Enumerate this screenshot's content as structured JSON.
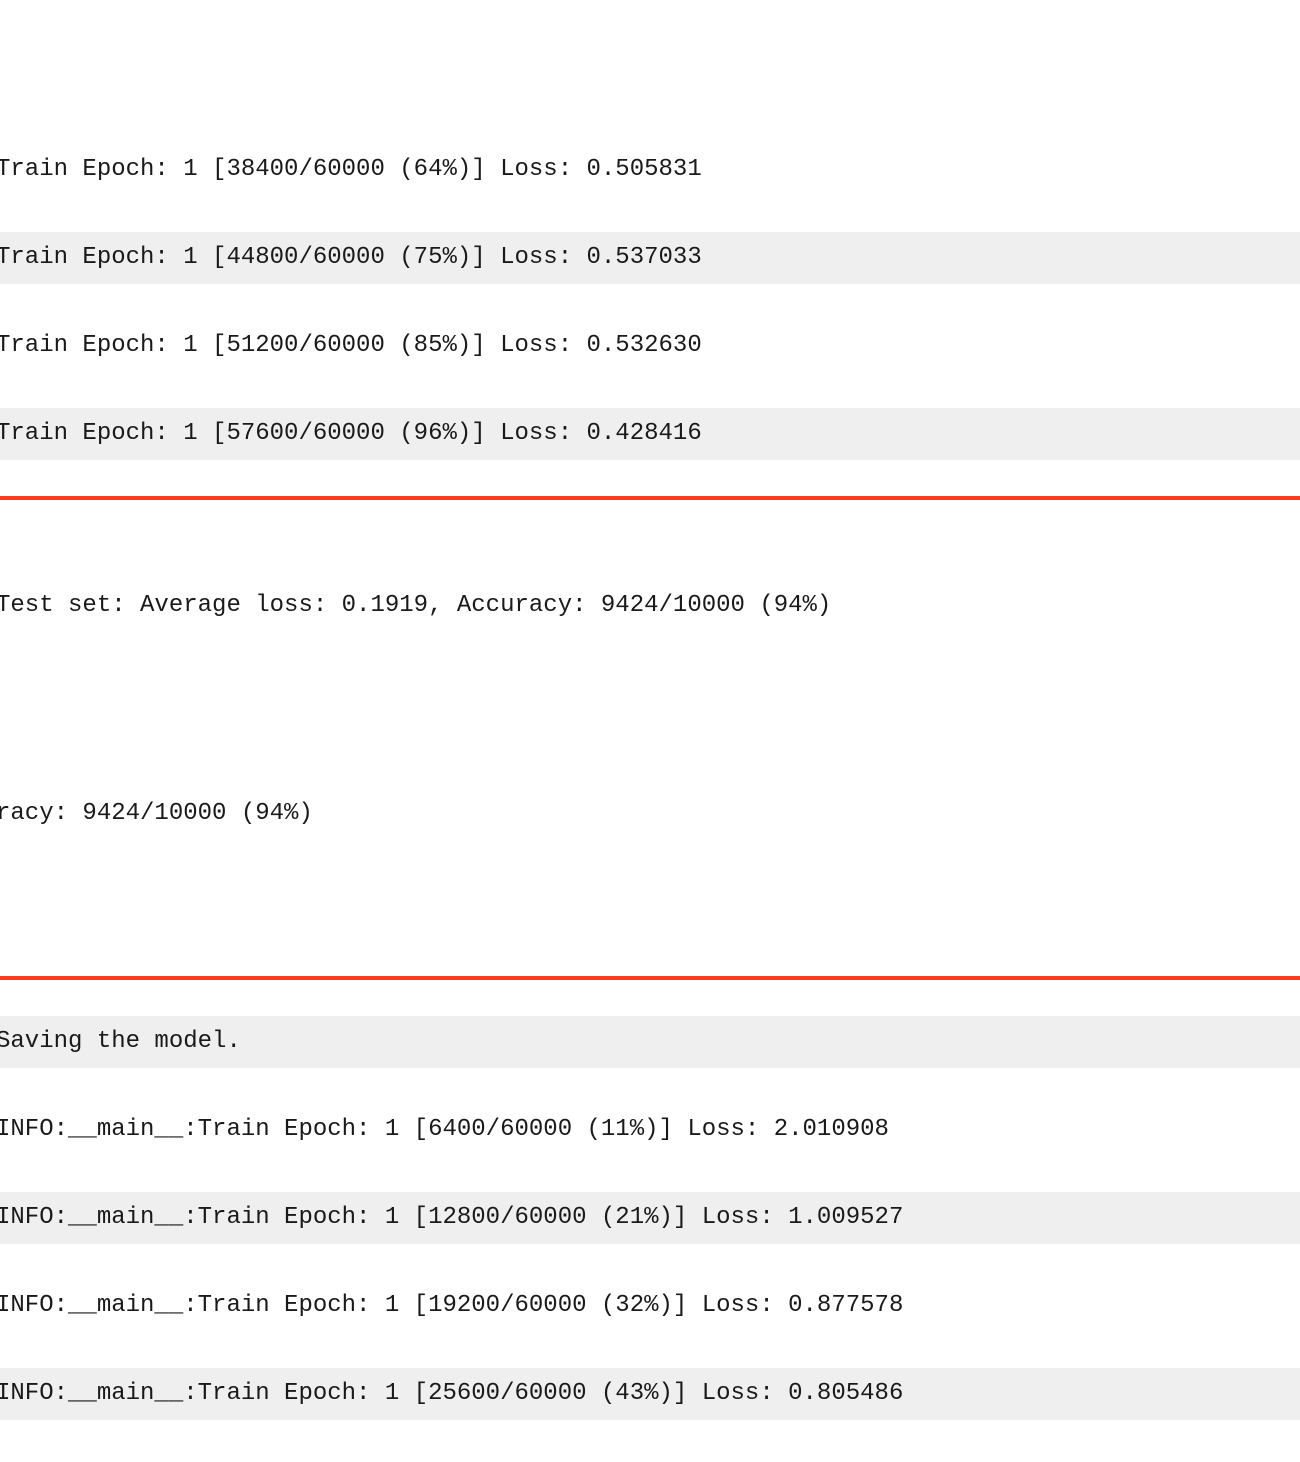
{
  "log": {
    "lines": {
      "l0": "Train Epoch: 1 [38400/60000 (64%)] Loss: 0.505831",
      "l1": "Train Epoch: 1 [44800/60000 (75%)] Loss: 0.537033",
      "l2": "Train Epoch: 1 [51200/60000 (85%)] Loss: 0.532630",
      "l3": "Train Epoch: 1 [57600/60000 (96%)] Loss: 0.428416",
      "t0": "Test set: Average loss: 0.1919, Accuracy: 9424/10000 (94%)",
      "t1": "racy: 9424/10000 (94%)",
      "l4": "Saving the model.",
      "l5": "INFO:__main__:Train Epoch: 1 [6400/60000 (11%)] Loss: 2.010908",
      "l6": "INFO:__main__:Train Epoch: 1 [12800/60000 (21%)] Loss: 1.009527",
      "l7": "INFO:__main__:Train Epoch: 1 [19200/60000 (32%)] Loss: 0.877578",
      "l8": "INFO:__main__:Train Epoch: 1 [25600/60000 (43%)] Loss: 0.805486"
    }
  }
}
